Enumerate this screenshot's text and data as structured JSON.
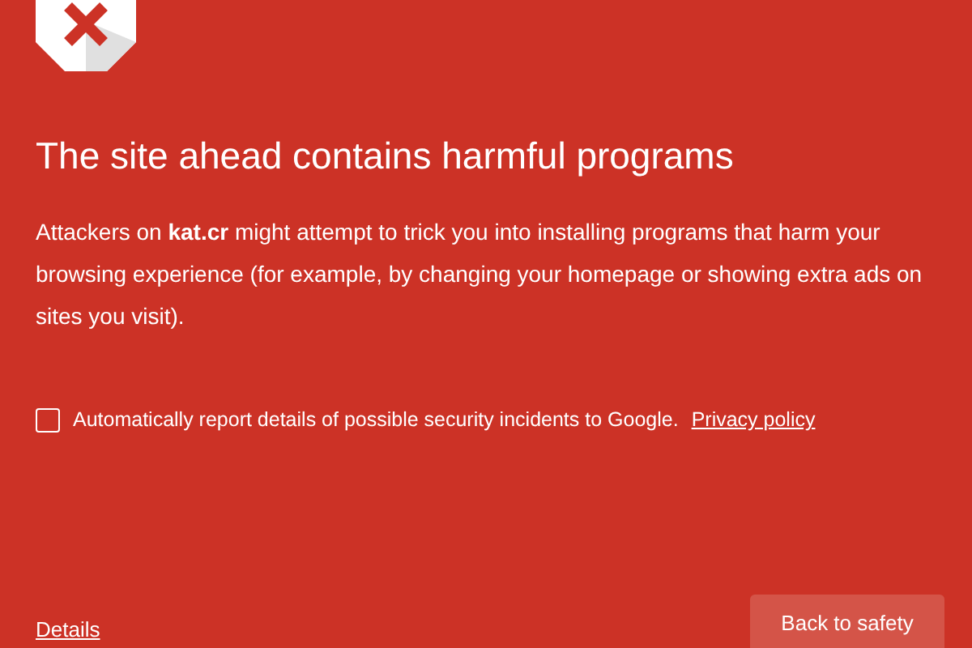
{
  "title": "The site ahead contains harmful programs",
  "message": "Attackers on **kat.cr** might attempt to trick you into installing programs that harm your browsing experience (for example, by changing your homepage or showing extra ads on sites you visit).",
  "report": {
    "checked": false,
    "label": "Automatically report details of possible security incidents to Google.",
    "link": "Privacy policy"
  },
  "details_link": "Details",
  "back_button": "Back to safety"
}
